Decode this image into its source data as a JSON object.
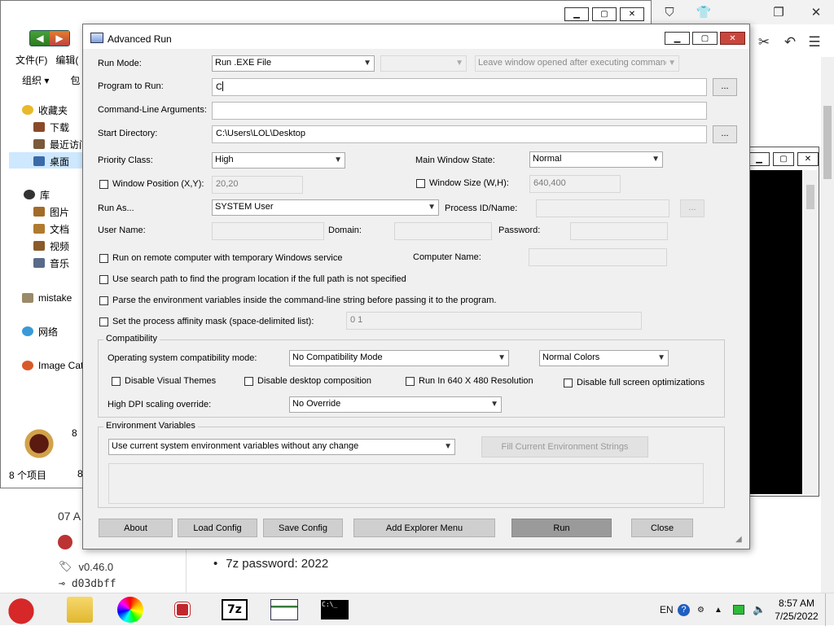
{
  "browser": {
    "tool_icons": [
      "shield-icon",
      "shirt-icon",
      "restore-icon",
      "close-icon"
    ],
    "toolbar_icons": [
      "scissors-icon",
      "undo-icon",
      "menu-icon"
    ]
  },
  "explorer": {
    "menu": [
      "文件(F)",
      "编辑("
    ],
    "organize": "组织 ▾",
    "organize_more": "包",
    "tree": [
      {
        "label": "收藏夹",
        "icon": "star-icon"
      },
      {
        "label": "下载",
        "icon": "folder-icon"
      },
      {
        "label": "最近访问",
        "icon": "folder-icon"
      },
      {
        "label": "桌面",
        "icon": "folder-icon"
      },
      {
        "label": "库",
        "icon": "library-icon"
      },
      {
        "label": "图片",
        "icon": "folder-icon"
      },
      {
        "label": "文档",
        "icon": "folder-icon"
      },
      {
        "label": "视频",
        "icon": "folder-icon"
      },
      {
        "label": "音乐",
        "icon": "folder-icon"
      },
      {
        "label": "mistake",
        "icon": "folder-icon"
      },
      {
        "label": "网络",
        "icon": "network-icon"
      },
      {
        "label": "Image Cat",
        "icon": "app-icon"
      }
    ],
    "status": "8 个项目",
    "item_count_a": "8",
    "item_count_b": "8"
  },
  "page": {
    "date": "07 A",
    "version": "v0.46.0",
    "hash": "d03dbff",
    "bullet": "7z password: 2022"
  },
  "dialog": {
    "title": "Advanced Run",
    "run_mode_label": "Run Mode:",
    "run_mode_value": "Run .EXE File",
    "run_mode_extra": "",
    "leave_window": "Leave window opened after executing command",
    "program_label": "Program to Run:",
    "program_value": "C",
    "cmdline_label": "Command-Line Arguments:",
    "cmdline_value": "",
    "startdir_label": "Start Directory:",
    "startdir_value": "C:\\Users\\LOL\\Desktop",
    "browse": "...",
    "priority_label": "Priority Class:",
    "priority_value": "High",
    "window_state_label": "Main Window State:",
    "window_state_value": "Normal",
    "window_pos_label": "Window Position (X,Y):",
    "window_pos_value": "20,20",
    "window_size_label": "Window Size (W,H):",
    "window_size_value": "640,400",
    "run_as_label": "Run As...",
    "run_as_value": "SYSTEM User",
    "process_label": "Process ID/Name:",
    "process_value": "",
    "user_label": "User Name:",
    "domain_label": "Domain:",
    "password_label": "Password:",
    "remote_label": "Run on remote computer with temporary Windows service",
    "computer_label": "Computer Name:",
    "search_path_label": "Use search path to find the program location if the full path is not specified",
    "parse_env_label": "Parse the environment variables inside the command-line string before passing it to the program.",
    "affinity_label": "Set the process affinity mask (space-delimited list):",
    "affinity_value": "0 1",
    "compat_group": "Compatibility",
    "os_compat_label": "Operating system compatibility mode:",
    "os_compat_value": "No Compatibility Mode",
    "colors_value": "Normal Colors",
    "disable_themes": "Disable Visual Themes",
    "disable_composition": "Disable desktop composition",
    "run_640": "Run In 640 X 480 Resolution",
    "disable_fullscreen": "Disable full screen optimizations",
    "dpi_label": "High DPI scaling override:",
    "dpi_value": "No Override",
    "env_group": "Environment Variables",
    "env_mode_value": "Use current system environment variables without any change",
    "fill_env": "Fill Current Environment Strings",
    "buttons": {
      "about": "About",
      "load": "Load Config",
      "save": "Save Config",
      "explorer_menu": "Add Explorer Menu",
      "run": "Run",
      "close": "Close"
    }
  },
  "taskbar": {
    "apps": [
      "angry-bird-icon",
      "folder-icon",
      "color-wheel-icon",
      "shield-app-icon",
      "7zip-icon",
      "advancedrun-icon",
      "cmd-icon"
    ],
    "sevenzip": "7z",
    "cmd_text": "C:\\_",
    "lang": "EN",
    "time": "8:57 AM",
    "date": "7/25/2022"
  }
}
